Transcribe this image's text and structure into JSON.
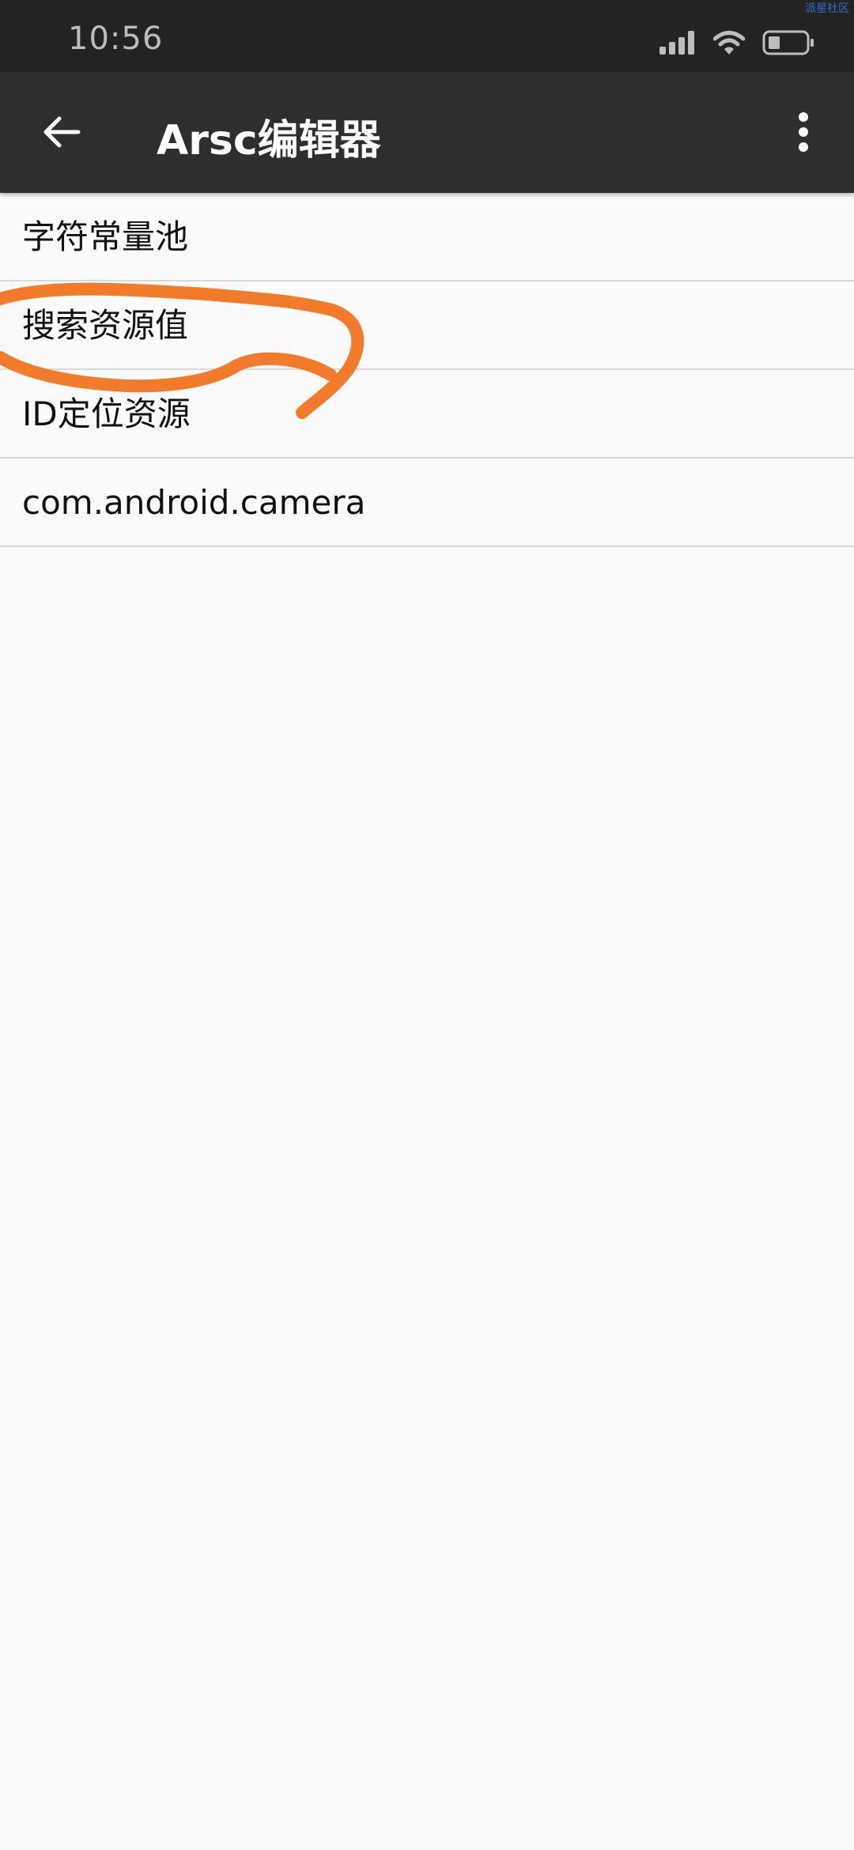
{
  "status_bar": {
    "time": "10:56",
    "icons": [
      "signal-icon",
      "wifi-icon",
      "battery-icon"
    ],
    "watermark": "派星社区"
  },
  "app_bar": {
    "title": "Arsc编辑器",
    "back_icon": "arrow-back-icon",
    "more_icon": "more-vert-icon"
  },
  "list": {
    "items": [
      {
        "label": "字符常量池"
      },
      {
        "label": "搜索资源值"
      },
      {
        "label": "ID定位资源"
      },
      {
        "label": "com.android.camera"
      }
    ]
  },
  "colors": {
    "status_bar_bg": "#232323",
    "app_bar_bg": "#2e2e2e",
    "background": "#fafafa",
    "divider": "#d9d9d9",
    "annotation_stroke": "#f27b2b"
  }
}
